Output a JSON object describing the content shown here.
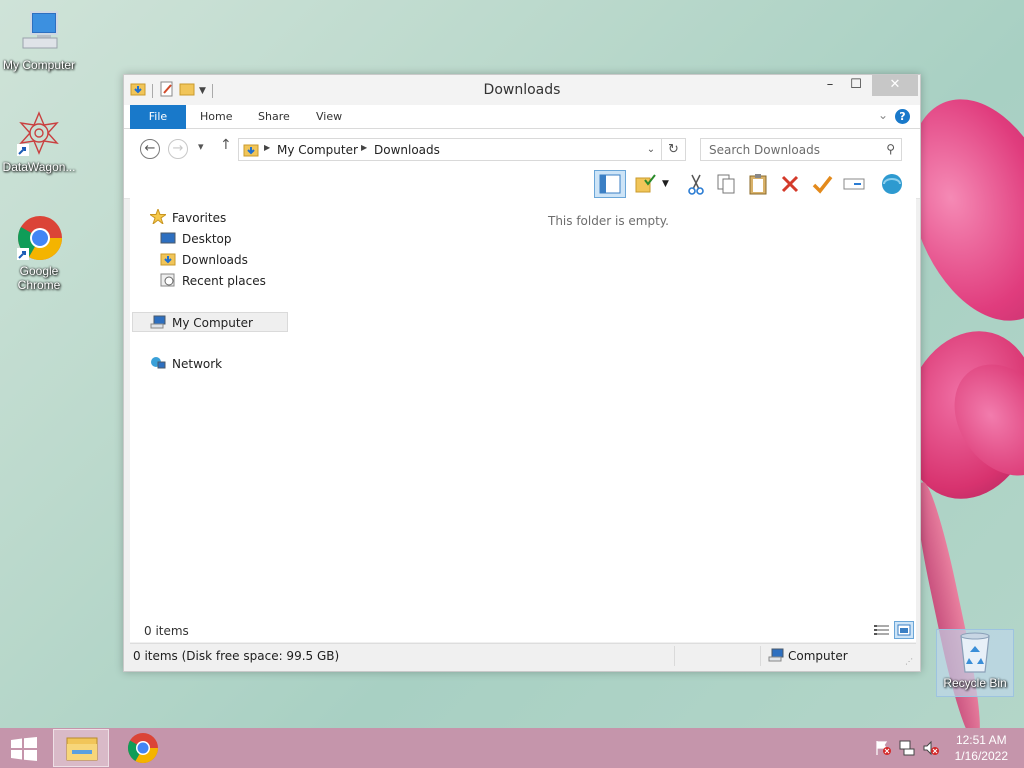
{
  "desktop": {
    "icons": [
      {
        "label": "My Computer"
      },
      {
        "label": "DataWagon..."
      },
      {
        "label": "Google Chrome"
      },
      {
        "label": "Recycle Bin"
      }
    ]
  },
  "window": {
    "title": "Downloads",
    "controls": {
      "minimize": "–",
      "maximize": "☐",
      "close": "✕"
    },
    "ribbon_tabs": [
      "File",
      "Home",
      "Share",
      "View"
    ],
    "help": "?",
    "address": {
      "crumbs": [
        "My Computer",
        "Downloads"
      ]
    },
    "search": {
      "placeholder": "Search Downloads"
    },
    "nav_pane": {
      "favorites": "Favorites",
      "favorites_items": [
        "Desktop",
        "Downloads",
        "Recent places"
      ],
      "computer": "My Computer",
      "network": "Network"
    },
    "empty_message": "This folder is empty.",
    "item_count": "0 items",
    "status": {
      "left": "0 items (Disk free space: 99.5 GB)",
      "right": "Computer"
    }
  },
  "taskbar": {
    "apps": [
      "file-explorer",
      "google-chrome"
    ],
    "clock": {
      "time": "12:51 AM",
      "date": "1/16/2022"
    }
  },
  "colors": {
    "accent": "#1979ca",
    "taskbar": "#c595ab",
    "flower": "#e4407f"
  }
}
